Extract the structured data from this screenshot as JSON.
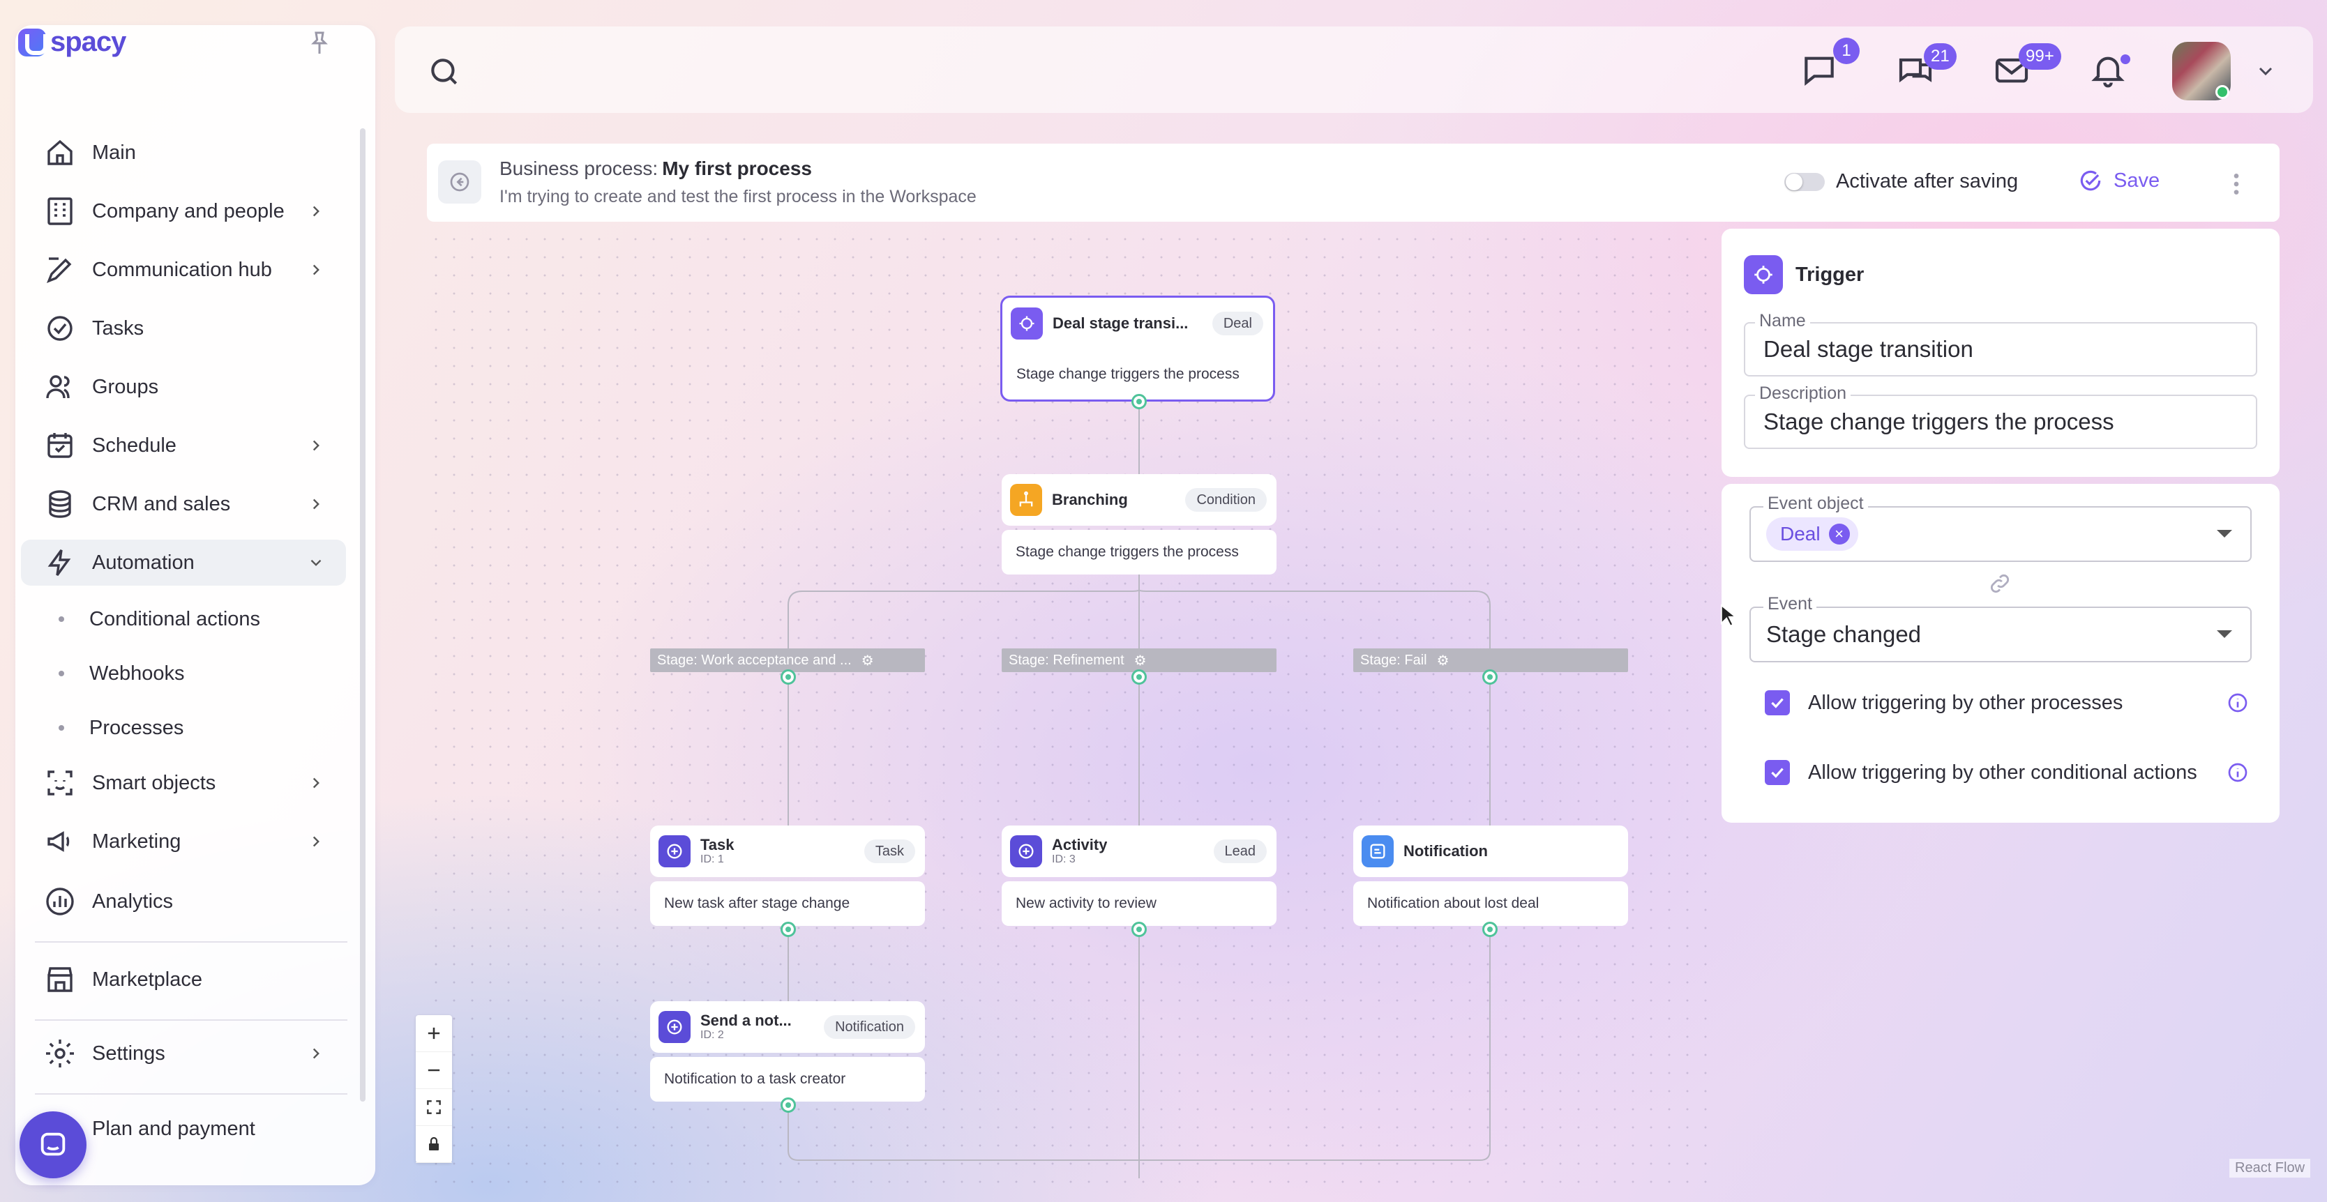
{
  "app": {
    "logo_text": "spacy"
  },
  "sidebar": {
    "items": [
      {
        "label": "Main",
        "icon": "home-icon",
        "has_chevron": false
      },
      {
        "label": "Company and people",
        "icon": "building-icon",
        "has_chevron": true
      },
      {
        "label": "Communication hub",
        "icon": "chat-edit-icon",
        "has_chevron": true
      },
      {
        "label": "Tasks",
        "icon": "check-circle-icon",
        "has_chevron": false
      },
      {
        "label": "Groups",
        "icon": "users-icon",
        "has_chevron": false
      },
      {
        "label": "Schedule",
        "icon": "calendar-icon",
        "has_chevron": true
      },
      {
        "label": "CRM and sales",
        "icon": "coins-icon",
        "has_chevron": true
      },
      {
        "label": "Automation",
        "icon": "bolt-icon",
        "has_chevron": true,
        "expanded": true
      },
      {
        "label": "Smart objects",
        "icon": "scan-icon",
        "has_chevron": true
      },
      {
        "label": "Marketing",
        "icon": "megaphone-icon",
        "has_chevron": true
      },
      {
        "label": "Analytics",
        "icon": "chart-icon",
        "has_chevron": false
      },
      {
        "label": "Marketplace",
        "icon": "store-icon",
        "has_chevron": false
      },
      {
        "label": "Settings",
        "icon": "gear-icon",
        "has_chevron": true
      },
      {
        "label": "Plan and payment",
        "icon": "card-icon",
        "has_chevron": false
      }
    ],
    "automation_sub": [
      "Conditional actions",
      "Webhooks",
      "Processes"
    ]
  },
  "topbar": {
    "messages_badge": "1",
    "chats_badge": "21",
    "mail_badge": "99+"
  },
  "process": {
    "label": "Business process:",
    "name": "My first process",
    "description": "I'm trying to create and test the first process in the Workspace",
    "activate_label": "Activate after saving",
    "activate_on": false,
    "save_label": "Save"
  },
  "flow": {
    "trigger": {
      "title": "Deal stage transi...",
      "tag": "Deal",
      "body": "Stage change triggers the process"
    },
    "branching": {
      "title": "Branching",
      "tag": "Condition",
      "body": "Stage change triggers the process"
    },
    "stages": [
      "Stage: Work acceptance and ...",
      "Stage: Refinement",
      "Stage: Fail"
    ],
    "task": {
      "title": "Task",
      "id": "ID: 1",
      "tag": "Task",
      "body": "New task after stage change"
    },
    "activity": {
      "title": "Activity",
      "id": "ID: 3",
      "tag": "Lead",
      "body": "New activity to review"
    },
    "notification": {
      "title": "Notification",
      "body": "Notification about lost deal"
    },
    "send": {
      "title": "Send a not...",
      "id": "ID: 2",
      "tag": "Notification",
      "body": "Notification to a task creator"
    },
    "attribution": "React Flow"
  },
  "panel": {
    "title": "Trigger",
    "name_label": "Name",
    "name_value": "Deal stage transition",
    "description_label": "Description",
    "description_value": "Stage change triggers the process",
    "event_object_label": "Event object",
    "event_object_chip": "Deal",
    "event_label": "Event",
    "event_value": "Stage changed",
    "check1": "Allow triggering by other processes",
    "check2": "Allow triggering by other conditional actions"
  },
  "colors": {
    "accent": "#7a5cf0",
    "handle": "#4fc39a",
    "branch_icon": "#f5a623",
    "notify_icon": "#4a8cf0"
  }
}
